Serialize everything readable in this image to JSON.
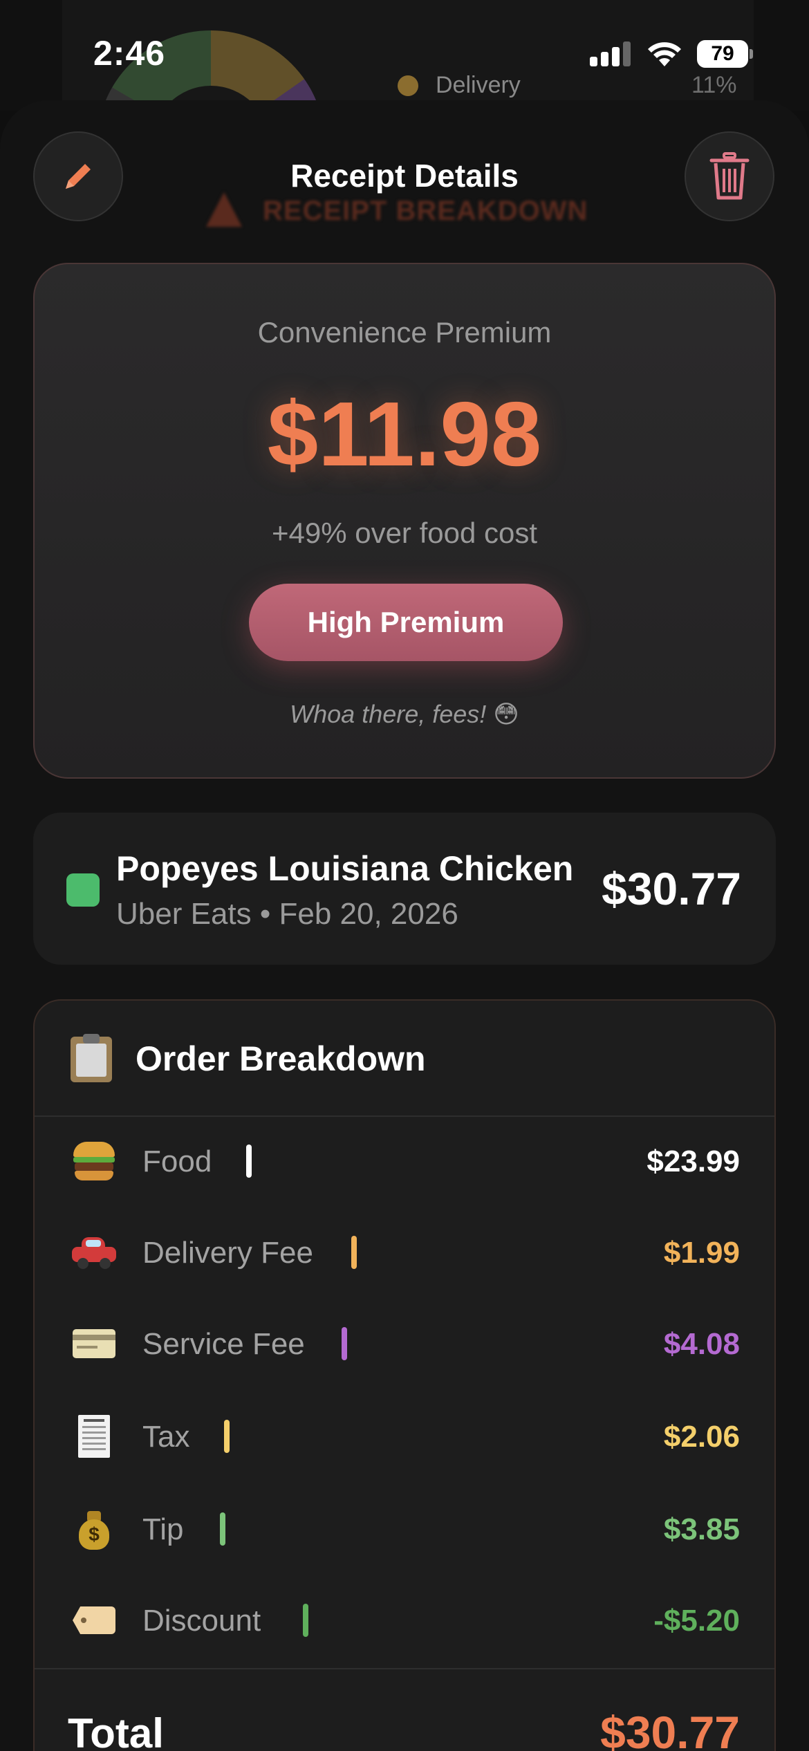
{
  "status_bar": {
    "time": "2:46",
    "battery": "79"
  },
  "background": {
    "legend_label": "Delivery",
    "legend_pct": "11%"
  },
  "header": {
    "title": "Receipt Details",
    "ghost_title": "RECEIPT BREAKDOWN",
    "edit_icon": "pencil-icon",
    "delete_icon": "trash-icon"
  },
  "premium": {
    "label": "Convenience Premium",
    "amount": "$11.98",
    "subtitle": "+49% over food cost",
    "badge": "High Premium",
    "note": "Whoa there, fees! 😳",
    "accent_color": "#ef7e52",
    "badge_color": "#b85e6f"
  },
  "merchant": {
    "name": "Popeyes Louisiana Chicken",
    "meta": "Uber Eats • Feb 20, 2026",
    "total": "$30.77",
    "dot_color": "#4cbb6c"
  },
  "breakdown": {
    "title": "Order Breakdown",
    "rows": [
      {
        "icon": "burger-icon",
        "label": "Food",
        "value": "$23.99",
        "color": "#ffffff"
      },
      {
        "icon": "car-icon",
        "label": "Delivery Fee",
        "value": "$1.99",
        "color": "#f2b35a"
      },
      {
        "icon": "credit-card-icon",
        "label": "Service Fee",
        "value": "$4.08",
        "color": "#b46ad1"
      },
      {
        "icon": "receipt-icon",
        "label": "Tax",
        "value": "$2.06",
        "color": "#f4cf6b"
      },
      {
        "icon": "money-bag-icon",
        "label": "Tip",
        "value": "$3.85",
        "color": "#7cc47a"
      },
      {
        "icon": "tag-icon",
        "label": "Discount",
        "value": "-$5.20",
        "color": "#5fb05c"
      }
    ],
    "total_label": "Total",
    "total_value": "$30.77"
  }
}
